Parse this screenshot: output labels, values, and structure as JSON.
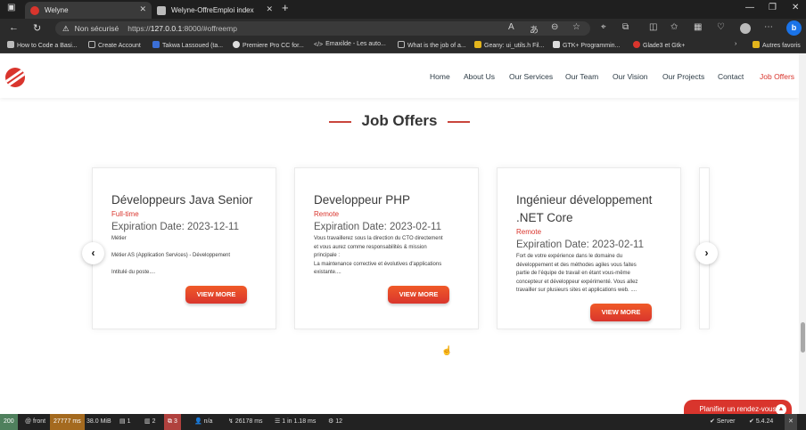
{
  "browser": {
    "tabs": [
      {
        "title": "Welyne",
        "active": true
      },
      {
        "title": "Welyne-OffreEmploi index",
        "active": false
      }
    ],
    "address": {
      "security_label": "Non sécurisé",
      "url_scheme": "https://",
      "url_host": "127.0.0.1",
      "url_rest": ":8000/#offreemp"
    },
    "bookmarks": [
      "How to Code a Basi...",
      "Create Account",
      "Takwa Lassoued (ta...",
      "Premiere Pro CC for...",
      "Emaxilde - Les auto...",
      "What is the job of a...",
      "Geany: ui_utils.h Fil...",
      "GTK+ Programmin...",
      "Glade3 et Gtk+"
    ],
    "bookmarks_other": "Autres favoris",
    "colors": {
      "chrome_dark": "#1f1f1f",
      "edge_blue": "#1a73e8"
    }
  },
  "site": {
    "nav": {
      "items": [
        "Home",
        "About Us",
        "Our Services",
        "Our Team",
        "Our Vision",
        "Our Projects",
        "Contact",
        "Job Offers"
      ],
      "active": "Job Offers"
    },
    "section_title": "Job Offers",
    "cards": [
      {
        "title": "Développeurs Java Senior",
        "type": "Full-time",
        "expiration": "Expiration Date: 2023-12-11",
        "description_lines": [
          "Métier",
          "",
          "Métier AS (Application Services) - Développement",
          "",
          "Intitulé du poste...."
        ],
        "button": "VIEW MORE"
      },
      {
        "title": "Developpeur PHP",
        "type": "Remote",
        "expiration": "Expiration Date: 2023-02-11",
        "description_lines": [
          "Vous travaillerez sous la direction du CTO directement",
          "et vous aurez comme responsabilités & mission",
          "principale :",
          "La maintenance corrective et évolutives d'applications",
          "existante...."
        ],
        "button": "VIEW MORE"
      },
      {
        "title": "Ingénieur développement .NET Core",
        "type": "Remote",
        "expiration": "Expiration Date: 2023-02-11",
        "description_lines": [
          "Fort de votre expérience dans le domaine du",
          "développement et des méthodes agiles vous faites",
          "partie de l'équipe de travail en étant vous-même",
          "concepteur et développeur expérimenté. Vous allez",
          "travailler sur plusieurs sites et applications web. ...."
        ],
        "button": "VIEW MORE"
      }
    ],
    "floating_button": "Planifier un rendez-vous",
    "accent_color": "#d9352d"
  },
  "debug_bar": {
    "status": "200",
    "route": "@ front",
    "time_ms": "27777 ms",
    "memory": "38.0 MiB",
    "forms": "1",
    "translations": "2",
    "security": "3",
    "user": "n/a",
    "ajax": "26178 ms",
    "db": "1 in 1.18 ms",
    "twig": "12",
    "server": "Server",
    "version": "5.4.24"
  }
}
